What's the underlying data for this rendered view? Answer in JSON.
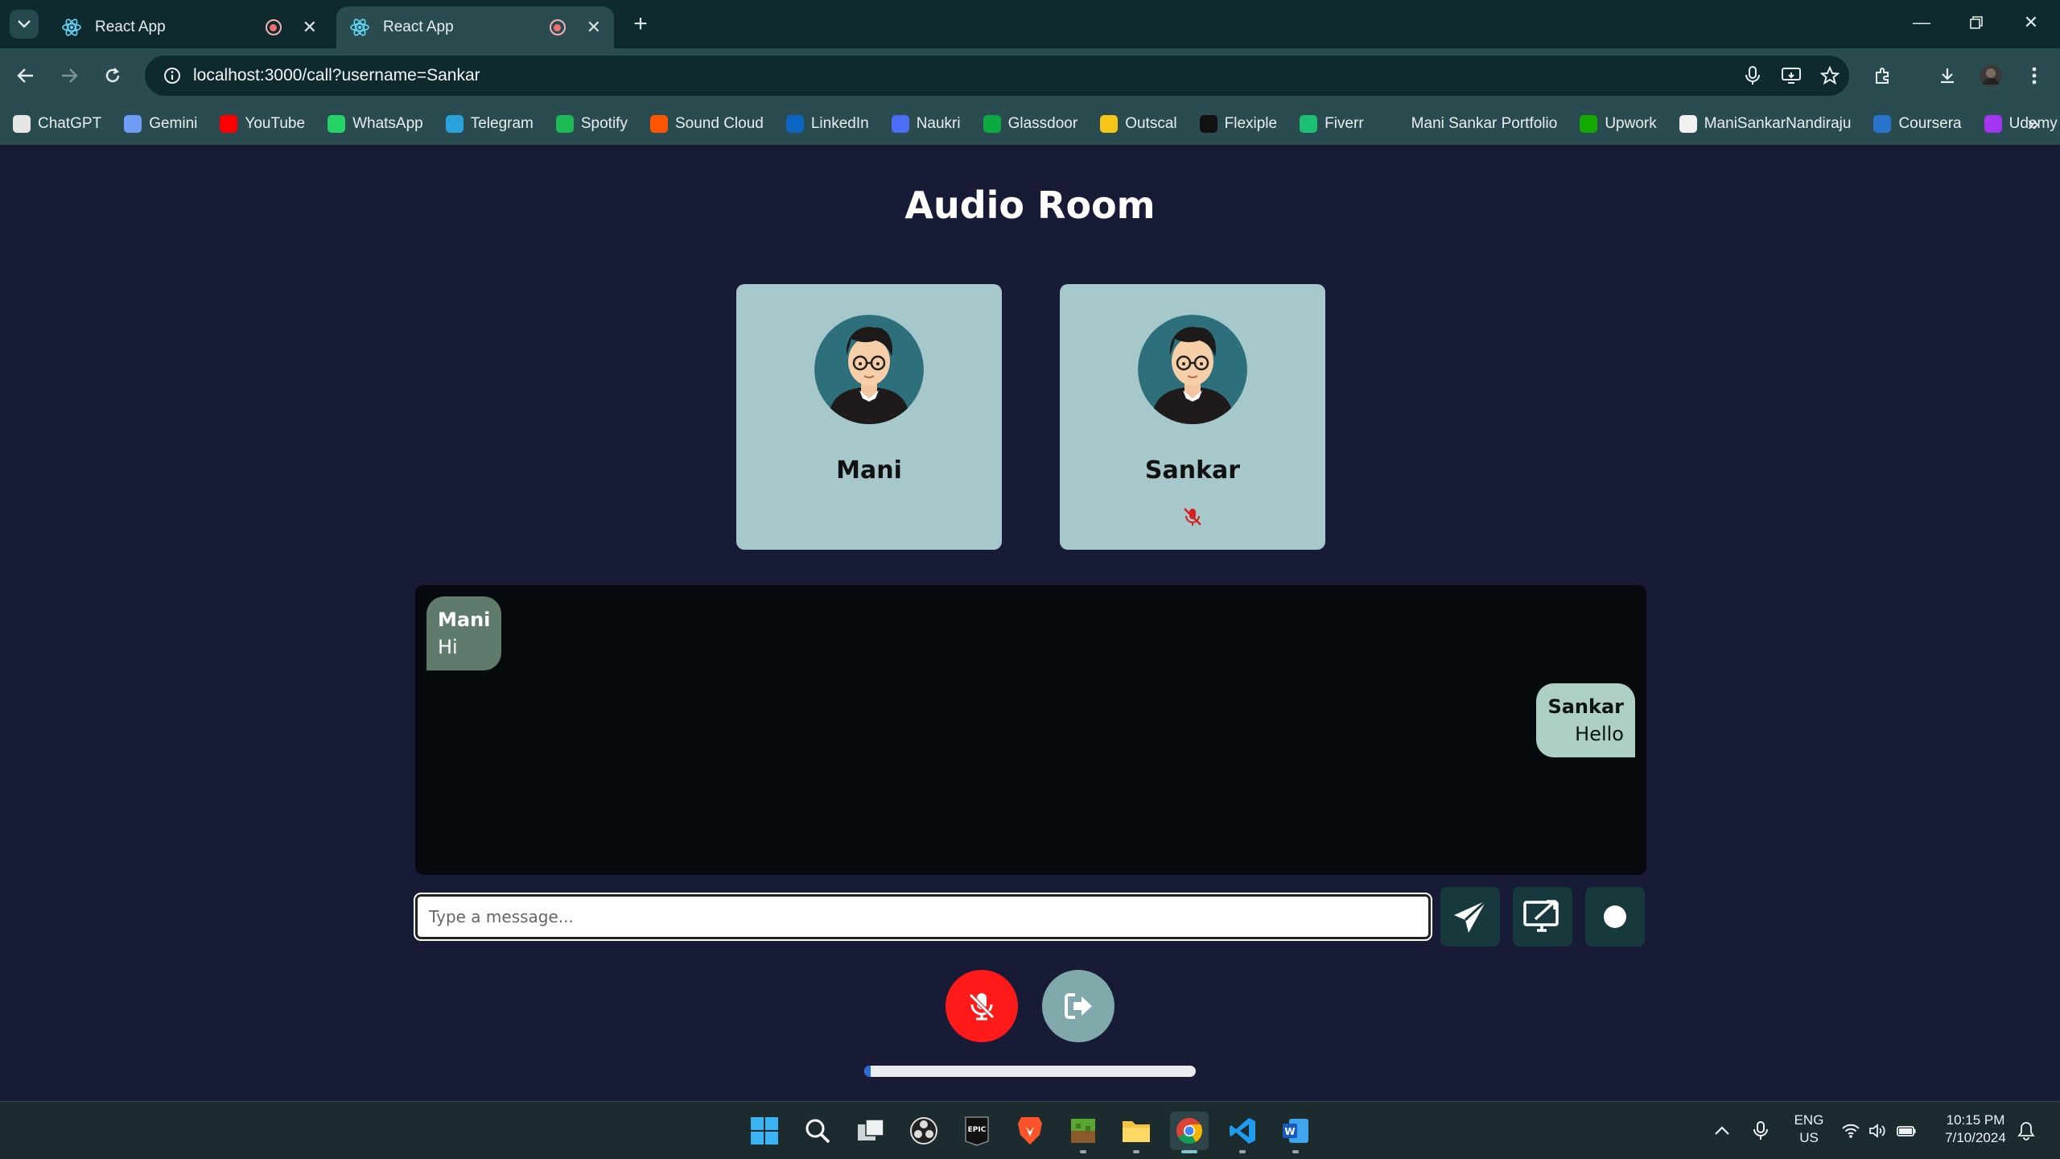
{
  "browser": {
    "tabs": [
      {
        "title": "React App",
        "active": false
      },
      {
        "title": "React App",
        "active": true
      }
    ],
    "url": "localhost:3000/call?username=Sankar",
    "bookmarks": [
      {
        "label": "ChatGPT",
        "icon": "chatgpt-icon",
        "color": "#e6e6e6"
      },
      {
        "label": "Gemini",
        "icon": "gemini-icon",
        "color": "#6f9cf5"
      },
      {
        "label": "YouTube",
        "icon": "youtube-icon",
        "color": "#ff0000"
      },
      {
        "label": "WhatsApp",
        "icon": "whatsapp-icon",
        "color": "#25d366"
      },
      {
        "label": "Telegram",
        "icon": "telegram-icon",
        "color": "#2aa1da"
      },
      {
        "label": "Spotify",
        "icon": "spotify-icon",
        "color": "#1db954"
      },
      {
        "label": "Sound Cloud",
        "icon": "soundcloud-icon",
        "color": "#ff5500"
      },
      {
        "label": "LinkedIn",
        "icon": "linkedin-icon",
        "color": "#0a66c2"
      },
      {
        "label": "Naukri",
        "icon": "naukri-icon",
        "color": "#4a6ef5"
      },
      {
        "label": "Glassdoor",
        "icon": "glassdoor-icon",
        "color": "#0caa41"
      },
      {
        "label": "Outscal",
        "icon": "outscal-icon",
        "color": "#f5c518"
      },
      {
        "label": "Flexiple",
        "icon": "flexiple-icon",
        "color": "#111111"
      },
      {
        "label": "Fiverr",
        "icon": "fiverr-icon",
        "color": "#1dbf73"
      },
      {
        "label": "Mani Sankar Portfolio",
        "icon": "portfolio-icon",
        "color": "#2a4c50"
      },
      {
        "label": "Upwork",
        "icon": "upwork-icon",
        "color": "#14a800"
      },
      {
        "label": "ManiSankarNandiraju",
        "icon": "github-icon",
        "color": "#f0f0f0"
      },
      {
        "label": "Coursera",
        "icon": "coursera-icon",
        "color": "#2a73cc"
      },
      {
        "label": "Udemy",
        "icon": "udemy-icon",
        "color": "#a435f0"
      }
    ]
  },
  "room": {
    "title": "Audio Room",
    "participants": [
      {
        "name": "Mani",
        "muted": false
      },
      {
        "name": "Sankar",
        "muted": true
      }
    ]
  },
  "chat": {
    "messages": [
      {
        "sender": "Mani",
        "text": "Hi",
        "side": "left"
      },
      {
        "sender": "Sankar",
        "text": "Hello",
        "side": "right"
      }
    ],
    "input_placeholder": "Type a message..."
  },
  "controls": {
    "send": "send-icon",
    "share_screen": "screen-share-icon",
    "record": "record-icon",
    "mute": "mic-off-icon",
    "leave": "leave-icon",
    "audio_level": 0.02
  },
  "colors": {
    "page_bg": "#181b36",
    "card_bg": "#a6c8cb",
    "chat_bg": "#040a0e",
    "mute_red": "#ff1a1a",
    "leave_teal": "#7fa9ab",
    "button_dark": "#17393d"
  },
  "taskbar": {
    "language": "ENG",
    "region": "US",
    "time": "10:15 PM",
    "date": "7/10/2024"
  }
}
